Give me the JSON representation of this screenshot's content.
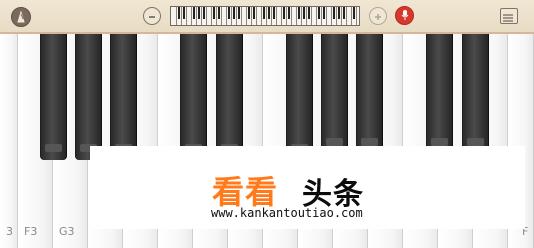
{
  "toolbar": {
    "left_icon": "metronome-icon",
    "minus_icon": "minus-icon",
    "mini_keyboard": "mini-keyboard-icon",
    "plus_icon": "plus-icon",
    "record_icon": "microphone-icon",
    "menu_icon": "list-menu-icon"
  },
  "keys": {
    "labels": [
      "3",
      "F3",
      "G3",
      "F"
    ]
  },
  "watermark": {
    "left": "看看",
    "right": "头条",
    "url": "www.kankantoutiao.com"
  }
}
